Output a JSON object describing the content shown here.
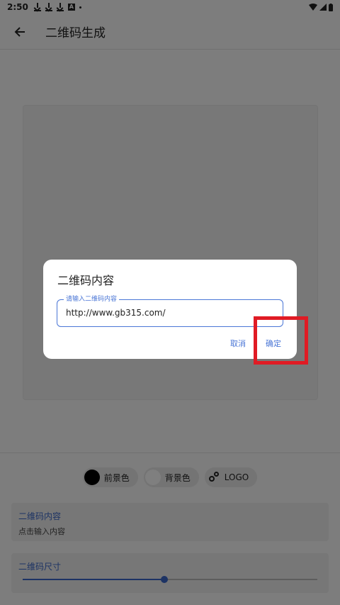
{
  "status_bar": {
    "time": "2:50",
    "icons": [
      "download-icon",
      "download-icon",
      "download-icon",
      "a-icon",
      "dot-icon"
    ],
    "right_icons": [
      "wifi-icon",
      "signal-icon",
      "battery-icon"
    ]
  },
  "app_bar": {
    "title": "二维码生成",
    "back_icon": "arrow-left-icon"
  },
  "chips": [
    {
      "label": "前景色",
      "color": "#000000"
    },
    {
      "label": "背景色",
      "color": "#ffffff"
    },
    {
      "label": "LOGO",
      "icon": "logo-icon"
    }
  ],
  "content_field": {
    "label": "二维码内容",
    "value": "点击输入内容"
  },
  "size_field": {
    "label": "二维码尺寸",
    "value_fraction": 0.48
  },
  "dialog": {
    "title": "二维码内容",
    "input_label": "请输入二维码内容",
    "input_value": "http://www.gb315.com/",
    "cancel_label": "取消",
    "confirm_label": "确定"
  },
  "colors": {
    "accent": "#3a67c9",
    "highlight": "#e01b24"
  }
}
